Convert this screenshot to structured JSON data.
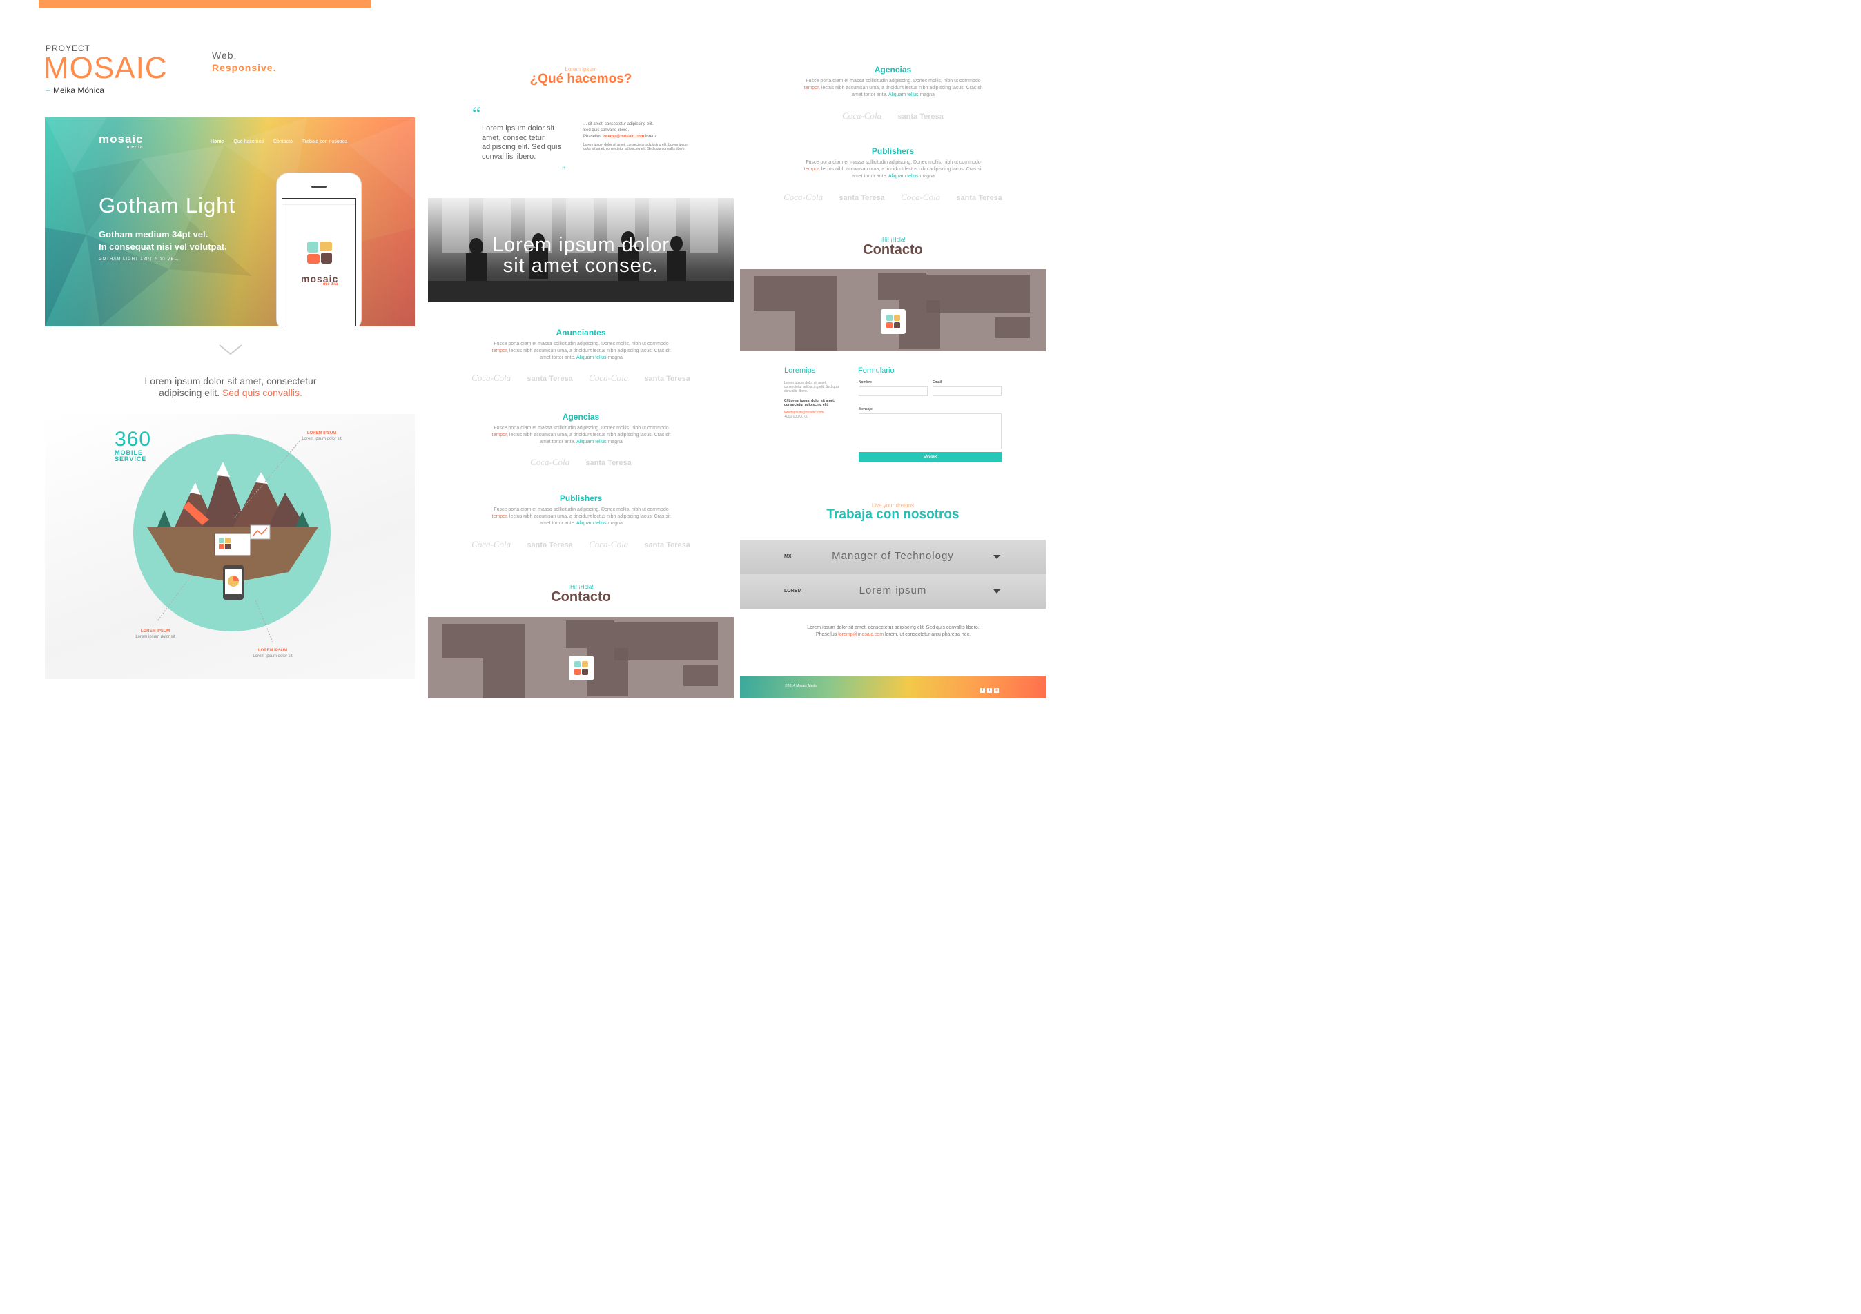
{
  "brand": {
    "proyect": "PROYECT",
    "mosaic": "MOSAIC",
    "author_plus": "+",
    "author": "Meika Mónica",
    "web": "Web.",
    "responsive": "Responsive."
  },
  "colors": {
    "accent_orange": "#ff8c4a",
    "accent_teal": "#1fc2b5",
    "brown": "#6d4c47",
    "map_gray": "#9e8e8b"
  },
  "hero": {
    "logo": "mosaic",
    "logo_sub": "media",
    "nav": [
      "Home",
      "Qué hacemos",
      "Contacto",
      "Trabaja con nosotros"
    ],
    "title": "Gotham Light",
    "subtitle_line1": "Gotham medium 34pt vel.",
    "subtitle_line2": "In consequat nisi vel volutpat.",
    "small": "GOTHAM LIGHT 18PT NISI VEL.",
    "phone_logo": "mosaic",
    "phone_logo_sub": "media"
  },
  "left_text": {
    "line1": "Lorem ipsum dolor sit amet, consectetur",
    "line2": "adipiscing elit.",
    "highlight": "Sed quis convallis."
  },
  "illustration": {
    "number": "360",
    "label_line1": "MOBILE",
    "label_line2": "SERVICE",
    "callouts": [
      {
        "title": "LOREM IPSUM",
        "text": "Lorem ipsum dolor sit"
      },
      {
        "title": "LOREM IPSUM",
        "text": "Lorem ipsum dolor sit"
      },
      {
        "title": "LOREM IPSUM",
        "text": "Lorem ipsum dolor sit"
      }
    ]
  },
  "column2": {
    "kicker": "Lorem ipsum",
    "title": "¿Qué hacemos?",
    "quote_open": "“",
    "quote": "Lorem ipsum dolor sit amet, consec tetur adipiscing elit. Sed quis conval lis libero.",
    "quote_close": "”",
    "side_line1": "... sit amet, consectetur adipiscing elit.",
    "side_line2": "Sed quis convallis libero.",
    "side_line3": "Phasellus",
    "side_email": "loremp@mosaic.com",
    "side_line3_end": "lorem.",
    "side_small": "Lorem ipsum dolor sit amet, consectetur adipiscing elit. Lorem ipsum dolor sit amet, consectetur adipiscing elit. Sed quis convallis libero.",
    "photo_text_line1": "Lorem ipsum dolor",
    "photo_text_line2": "sit amet consec.",
    "sections": [
      {
        "title": "Anunciantes",
        "logos": [
          "Coca-Cola",
          "santa Teresa",
          "Coca-Cola",
          "santa Teresa"
        ]
      },
      {
        "title": "Agencias",
        "logos": [
          "Coca-Cola",
          "santa Teresa"
        ]
      },
      {
        "title": "Publishers",
        "logos": [
          "Coca-Cola",
          "santa Teresa",
          "Coca-Cola",
          "santa Teresa"
        ]
      }
    ],
    "section_body_a": "Fusce porta diam et massa sollicitudin adipiscing. Donec mollis, nibh ut commodo",
    "section_body_tempor": "tempor",
    "section_body_b": ", lectus nibh accumsan urna, a tincidunt lectus nibh adipiscing lacus. Cras sit amet tortor ante.",
    "section_body_aliquam": "Aliquam tellus",
    "section_body_c": "magna",
    "hola": "¡Hi! ¡Hola!",
    "contact_title": "Contacto"
  },
  "column3": {
    "sections": [
      {
        "title": "Agencias",
        "logos": [
          "Coca-Cola",
          "santa Teresa"
        ]
      },
      {
        "title": "Publishers",
        "logos": [
          "Coca-Cola",
          "santa Teresa",
          "Coca-Cola",
          "santa Teresa"
        ]
      }
    ],
    "hola": "¡Hi! ¡Hola!",
    "contact_title": "Contacto",
    "loremips": "Loremips",
    "formulario": "Formulario",
    "addr_text": "Lorem ipsum dolor sit amet, consectetur adipiscing elit. Sed quis convallis libero.",
    "addr_bold": "C/ Lorem ipsum dolor sit amet, consectetur adipiscing elit.",
    "addr_email": "loremipsum@mosaic.com",
    "addr_phone": "+000 000 00 00",
    "field_nombre": "Nombre",
    "field_email": "Email",
    "field_mensaje": "Mensaje",
    "send": "ENVIAR",
    "trabaja_kicker": "Live your dreams",
    "trabaja_title": "Trabaja con nosotros",
    "select1_code": "MX",
    "select1_value": "Manager of Technology",
    "select2_code": "LOREM",
    "select2_value": "Lorem ipsum",
    "body_a": "Lorem ipsum dolor sit amet, consectetur adipiscing elit. Sed quis convallis libero. Phasellus",
    "body_email": "loremp@mosaic.com",
    "body_b": "lorem, ut consectetur arcu pharetra nec.",
    "footer_copy": "©2014 Mosaic Media",
    "social": [
      "f",
      "t",
      "in"
    ]
  }
}
